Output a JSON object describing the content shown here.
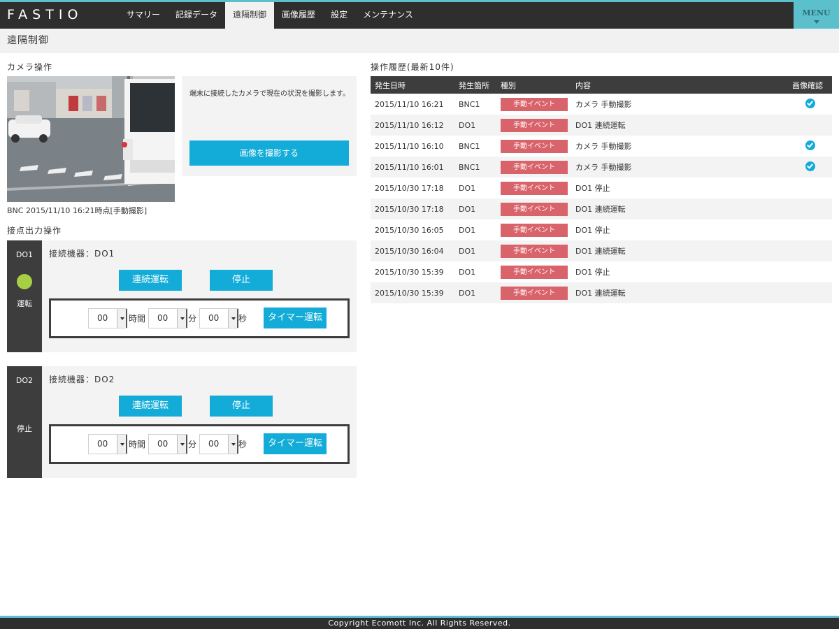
{
  "header": {
    "logo": "FASTIO",
    "nav": [
      "サマリー",
      "記録データ",
      "遠隔制御",
      "画像履歴",
      "設定",
      "メンテナンス"
    ],
    "active_index": 2,
    "menu_label": "MENU"
  },
  "page_title": "遠隔制御",
  "camera": {
    "section_title": "カメラ操作",
    "caption": "BNC 2015/11/10 16:21時点[手動撮影]",
    "description": "端末に接続したカメラで現在の状況を撮影します。",
    "capture_button": "画像を撮影する"
  },
  "outputs": {
    "section_title": "接点出力操作",
    "blocks": [
      {
        "id": "DO1",
        "status": "運転",
        "led_color": "#a6cf43",
        "device": "接続機器：DO1",
        "continuous_button": "連続運転",
        "stop_button": "停止",
        "timer": {
          "hours": "00",
          "hours_unit": "時間",
          "minutes": "00",
          "minutes_unit": "分",
          "seconds": "00",
          "seconds_unit": "秒"
        },
        "timer_button": "タイマー運転"
      },
      {
        "id": "DO2",
        "status": "停止",
        "device": "接続機器：DO2",
        "continuous_button": "連続運転",
        "stop_button": "停止",
        "timer": {
          "hours": "00",
          "hours_unit": "時間",
          "minutes": "00",
          "minutes_unit": "分",
          "seconds": "00",
          "seconds_unit": "秒"
        },
        "timer_button": "タイマー運転"
      }
    ]
  },
  "history": {
    "section_title": "操作履歴(最新10件)",
    "columns": [
      "発生日時",
      "発生箇所",
      "種別",
      "内容",
      "画像確認"
    ],
    "rows": [
      {
        "datetime": "2015/11/10 16:21",
        "location": "BNC1",
        "kind": "手動イベント",
        "content": "カメラ 手動撮影",
        "has_image": true
      },
      {
        "datetime": "2015/11/10 16:12",
        "location": "DO1",
        "kind": "手動イベント",
        "content": "DO1 連続運転",
        "has_image": false
      },
      {
        "datetime": "2015/11/10 16:10",
        "location": "BNC1",
        "kind": "手動イベント",
        "content": "カメラ 手動撮影",
        "has_image": true
      },
      {
        "datetime": "2015/11/10 16:01",
        "location": "BNC1",
        "kind": "手動イベント",
        "content": "カメラ 手動撮影",
        "has_image": true
      },
      {
        "datetime": "2015/10/30 17:18",
        "location": "DO1",
        "kind": "手動イベント",
        "content": "DO1 停止",
        "has_image": false
      },
      {
        "datetime": "2015/10/30 17:18",
        "location": "DO1",
        "kind": "手動イベント",
        "content": "DO1 連続運転",
        "has_image": false
      },
      {
        "datetime": "2015/10/30 16:05",
        "location": "DO1",
        "kind": "手動イベント",
        "content": "DO1 停止",
        "has_image": false
      },
      {
        "datetime": "2015/10/30 16:04",
        "location": "DO1",
        "kind": "手動イベント",
        "content": "DO1 連続運転",
        "has_image": false
      },
      {
        "datetime": "2015/10/30 15:39",
        "location": "DO1",
        "kind": "手動イベント",
        "content": "DO1 停止",
        "has_image": false
      },
      {
        "datetime": "2015/10/30 15:39",
        "location": "DO1",
        "kind": "手動イベント",
        "content": "DO1 連続運転",
        "has_image": false
      }
    ]
  },
  "footer": "Copyright Ecomott Inc. All Rights Reserved.",
  "colors": {
    "accent": "#13acd8",
    "header_bg": "#2e2e2e",
    "header_border": "#5bbfcc",
    "event_badge": "#d9636b",
    "led_on": "#a6cf43"
  }
}
